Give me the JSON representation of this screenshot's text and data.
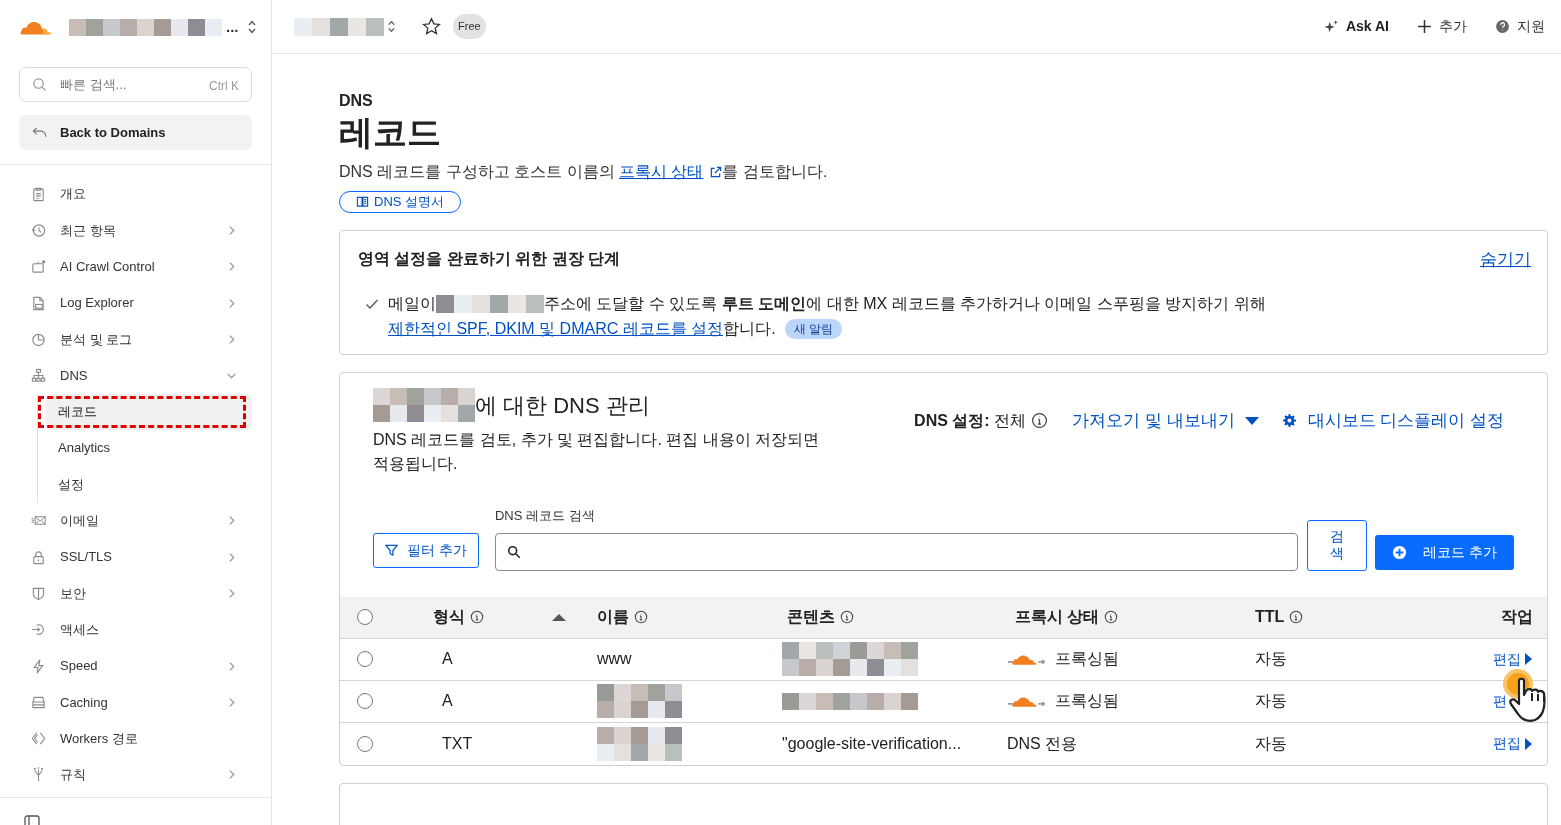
{
  "sidebar": {
    "account_more": "...",
    "search": {
      "placeholder": "빠른 검색...",
      "shortcut": "Ctrl K"
    },
    "back_button": "Back to Domains",
    "items": [
      {
        "label": "개요"
      },
      {
        "label": "최근 항목",
        "expanded": false
      },
      {
        "label": "AI Crawl Control",
        "expanded": false
      },
      {
        "label": "Log Explorer",
        "expanded": false
      },
      {
        "label": "분석 및 로그",
        "expanded": false
      },
      {
        "label": "DNS",
        "expanded": true,
        "children": [
          {
            "label": "레코드",
            "selected": true,
            "highlighted": true
          },
          {
            "label": "Analytics",
            "selected": false,
            "highlighted": false
          },
          {
            "label": "설정",
            "selected": false,
            "highlighted": false
          }
        ]
      },
      {
        "label": "이메일",
        "expanded": false
      },
      {
        "label": "SSL/TLS",
        "expanded": false
      },
      {
        "label": "보안",
        "expanded": false
      },
      {
        "label": "액세스"
      },
      {
        "label": "Speed",
        "expanded": false
      },
      {
        "label": "Caching",
        "expanded": false
      },
      {
        "label": "Workers 경로"
      },
      {
        "label": "규칙",
        "expanded": false
      }
    ]
  },
  "topbar": {
    "plan_badge": "Free",
    "favorite": false,
    "actions": [
      {
        "label": "Ask AI"
      },
      {
        "label": "추가"
      },
      {
        "label": "지원"
      }
    ]
  },
  "page": {
    "eyebrow": "DNS",
    "title": "레코드",
    "description_before": "DNS 레코드를 구성하고 호스트 이름의 ",
    "description_link": "프록시 상태",
    "description_after": "를 검토합니다.",
    "docs_button": "DNS 설명서"
  },
  "recommendation": {
    "title": "영역 설정을 완료하기 위한 권장 단계",
    "hide_link": "숨기기",
    "text_start": "메일이",
    "text_middle": "주소에 도달할 수 있도록 **루트 도메인**에 대한 MX 레코드를 추가하거나 이메일 스푸핑을 방지하기 위해",
    "link": "제한적인 SPF, DKIM 및 DMARC 레코드를 설정",
    "text_end": "합니다.",
    "badge": "새 알림"
  },
  "manage": {
    "title_suffix": "에 대한 DNS 관리",
    "description": "DNS 레코드를 검토, 추가 및 편집합니다. 편집 내용이 저장되면 적용됩니다.",
    "dns_setting": "**DNS 설정:** 전체",
    "import_export": "가져오기 및 내보내기",
    "display_settings": "대시보드 디스플레이 설정",
    "filter_button": "필터 추가",
    "search_label": "DNS 레코드 검색",
    "search_button": "검색",
    "add_button": "레코드 추가"
  },
  "table": {
    "select_all": {
      "checked": false
    },
    "columns": [
      {
        "label": "형식",
        "info": true
      },
      {
        "label": "이름",
        "info": true
      },
      {
        "label": "콘텐츠",
        "info": true
      },
      {
        "label": "프록시 상태",
        "info": true
      },
      {
        "label": "TTL",
        "info": true
      },
      {
        "label": "작업",
        "info": false
      }
    ],
    "rows": [
      {
        "checked": false,
        "type": "A",
        "name": "www",
        "proxy": {
          "kind": "proxied",
          "label": "프록싱됨"
        },
        "ttl": "자동",
        "action": "편집"
      },
      {
        "checked": false,
        "type": "A",
        "proxy": {
          "kind": "proxied",
          "label": "프록싱됨"
        },
        "ttl": "자동",
        "action": "편",
        "cursor": true
      },
      {
        "checked": false,
        "type": "TXT",
        "content": "\"google-site-verification...",
        "proxy": {
          "kind": "dns_only",
          "label": "DNS 전용"
        },
        "ttl": "자동",
        "action": "편집"
      }
    ]
  }
}
